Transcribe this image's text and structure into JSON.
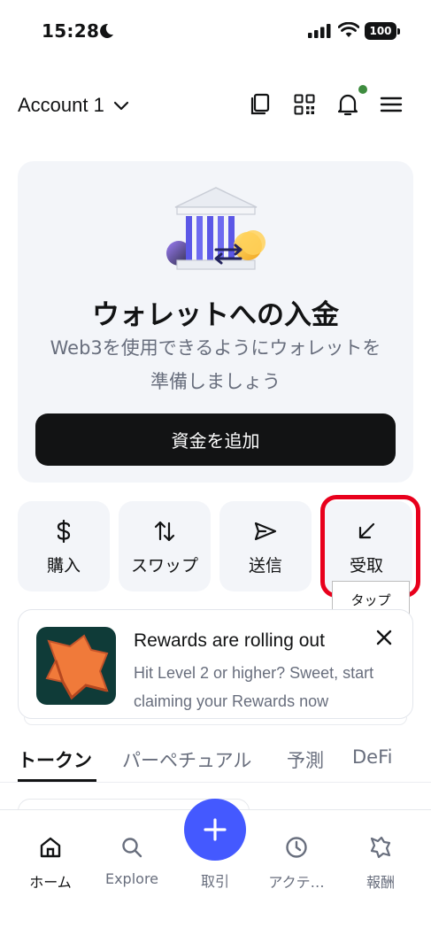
{
  "status_bar": {
    "time": "15:28",
    "battery": "100"
  },
  "header": {
    "account_name": "Account 1"
  },
  "fund_card": {
    "title": "ウォレットへの入金",
    "subtitle_line1": "Web3を使用できるようにウォレットを",
    "subtitle_line2": "準備しましょう",
    "button_label": "資金を追加"
  },
  "actions": [
    {
      "label": "購入",
      "icon": "dollar-icon"
    },
    {
      "label": "スワップ",
      "icon": "swap-arrows-icon"
    },
    {
      "label": "送信",
      "icon": "send-icon"
    },
    {
      "label": "受取",
      "icon": "receive-arrow-icon"
    }
  ],
  "annotation": {
    "tooltip": "タップ",
    "highlight_color": "#e8001c"
  },
  "rewards": {
    "title": "Rewards are rolling out",
    "body": "Hit Level 2 or higher? Sweet, start claiming your Rewards now"
  },
  "tabs": [
    {
      "label": "トークン",
      "active": true
    },
    {
      "label": "パーペチュアル"
    },
    {
      "label": "予測"
    },
    {
      "label": "DeFi"
    }
  ],
  "bottom_nav": [
    {
      "label": "ホーム",
      "icon": "home-icon",
      "active": true
    },
    {
      "label": "Explore",
      "icon": "search-icon"
    },
    {
      "label": "取引",
      "icon": "plus-icon"
    },
    {
      "label": "アクテ…",
      "icon": "clock-icon"
    },
    {
      "label": "報酬",
      "icon": "rewards-icon"
    }
  ],
  "colors": {
    "accent": "#4459ff",
    "dark": "#121314",
    "muted": "#686e7d",
    "card": "#f3f5f9",
    "notification": "#3e8c3f"
  }
}
